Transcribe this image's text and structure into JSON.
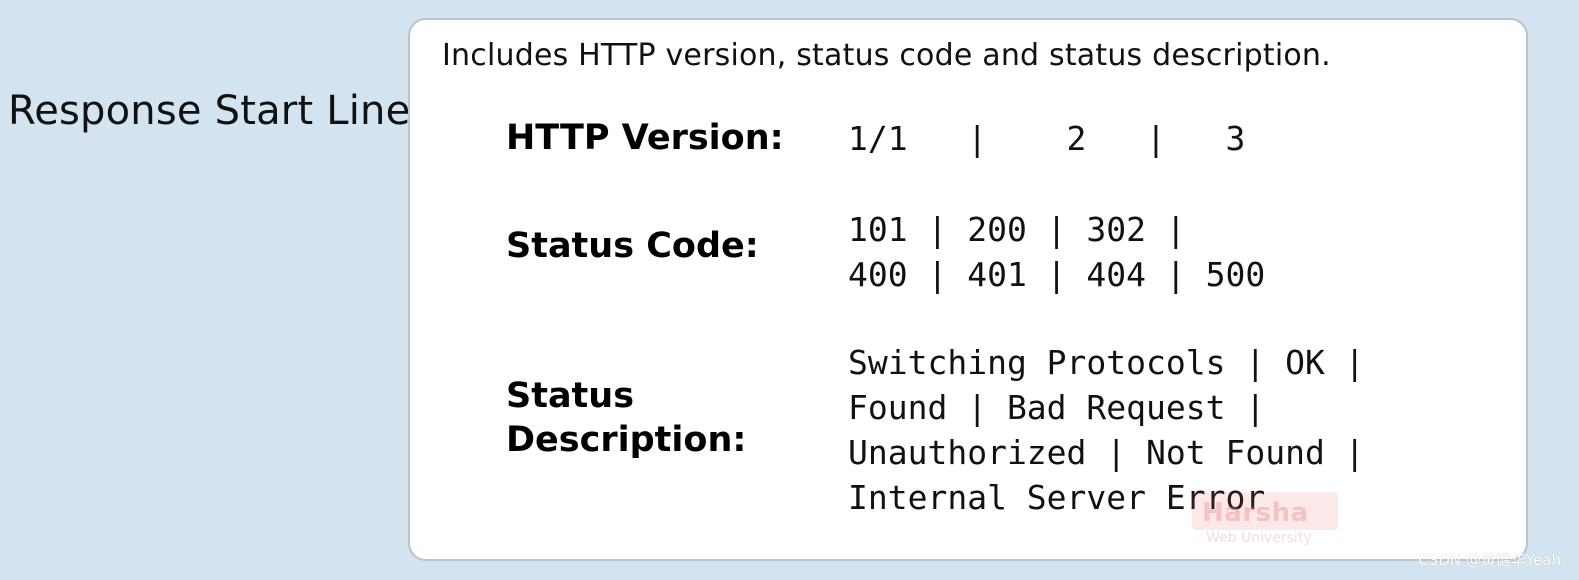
{
  "side_title": "Response Start Line",
  "card": {
    "lead": "Includes HTTP version, status code and status description.",
    "rows": [
      {
        "label": "HTTP Version:",
        "value": "1/1   |    2   |   3"
      },
      {
        "label": "Status Code:",
        "value": "101 | 200 | 302 |\n400 | 401 | 404 | 500"
      },
      {
        "label": "Status\nDescription:",
        "value": "Switching Protocols | OK |\nFound | Bad Request |\nUnauthorized | Not Found |\nInternal Server Error"
      }
    ]
  },
  "watermark": {
    "logo": "Harsha",
    "subtitle": "Web University"
  },
  "credit": "CSDN @黄健华Yeah",
  "colors": {
    "background": "#d3e3ef",
    "card": "#ffffff"
  }
}
